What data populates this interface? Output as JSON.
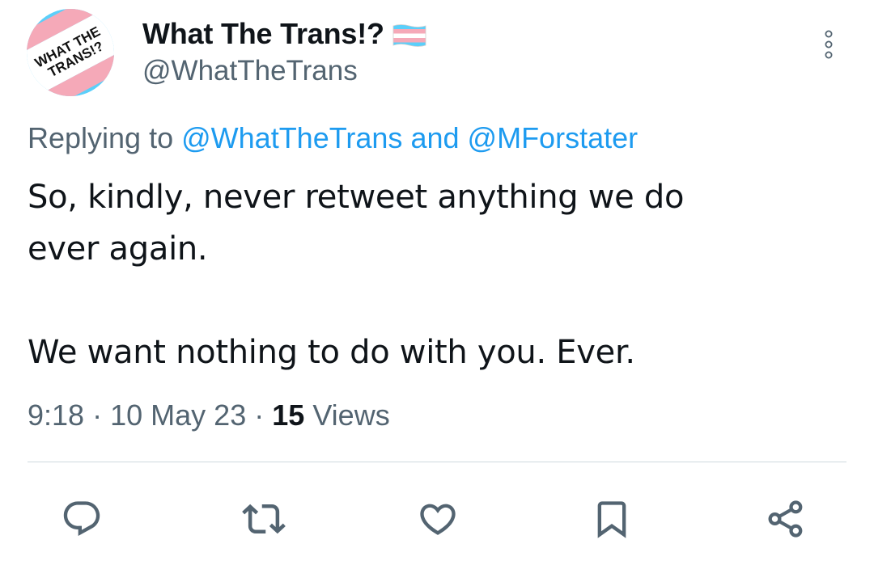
{
  "author": {
    "display_name": "What The Trans!?",
    "handle": "@WhatTheTrans",
    "avatar_text": "WHAT THE TRANS!?",
    "flag_icon": "transgender-flag-icon"
  },
  "reply": {
    "prefix": "Replying to",
    "mention1": "@WhatTheTrans",
    "conjunction": "and",
    "mention2": "@MForstater"
  },
  "tweet": {
    "line1": "So, kindly, never retweet anything we do",
    "line2": "ever again.",
    "line3": "We want nothing to do with you. Ever."
  },
  "meta": {
    "time": "9:18",
    "date": "10 May 23",
    "views_count": "15",
    "views_label": "Views"
  },
  "actions": [
    "reply-icon",
    "retweet-icon",
    "like-icon",
    "bookmark-icon",
    "share-icon"
  ],
  "colors": {
    "link": "#1d9bf0",
    "secondary_text": "#536471",
    "primary_text": "#0f1419",
    "trans_blue": "#5bcffa",
    "trans_pink": "#f5a9b8",
    "trans_white": "#ffffff"
  }
}
